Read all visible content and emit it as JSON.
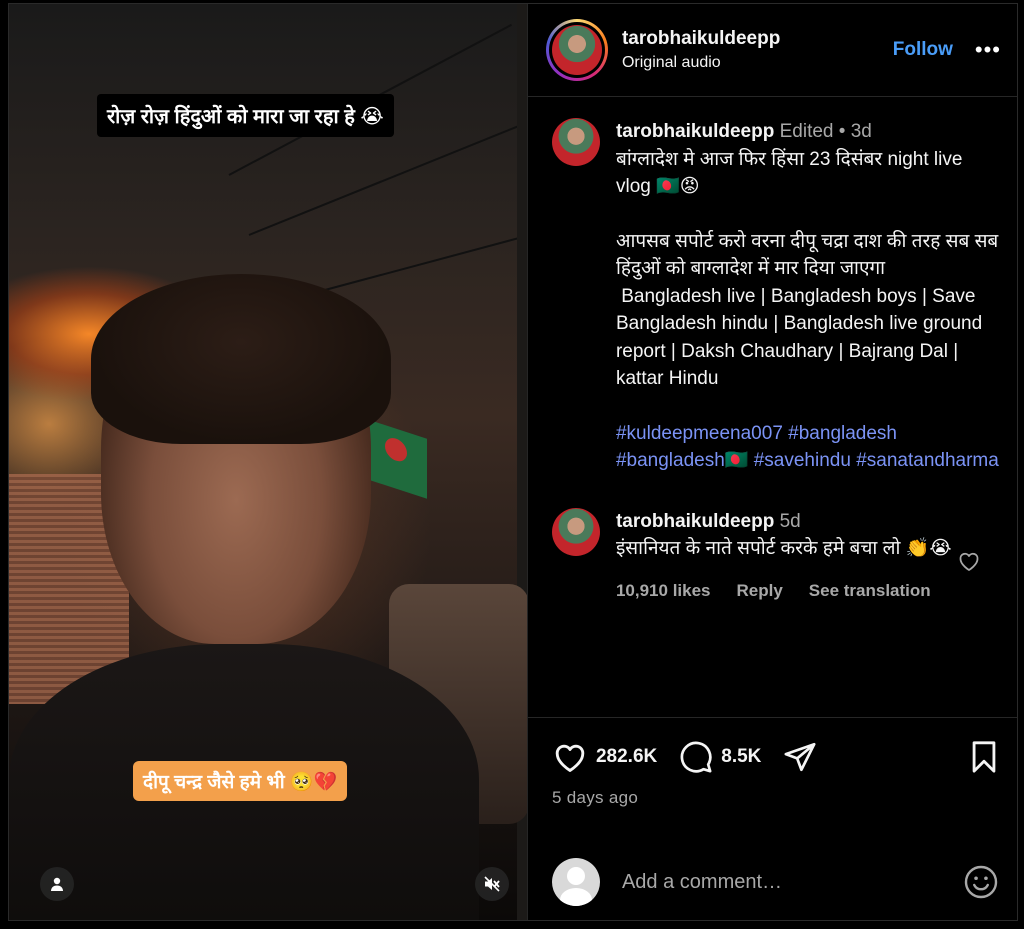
{
  "video": {
    "caption_top": "रोज़ रोज़ हिंदुओं को मारा जा रहा हे 😭",
    "caption_bottom": "दीपू चन्द्र जैसे हमे भी 🥺💔"
  },
  "header": {
    "username": "tarobhaikuldeepp",
    "audio": "Original audio",
    "follow_label": "Follow",
    "more_label": "•••"
  },
  "post": {
    "username": "tarobhaikuldeepp",
    "edited": "Edited",
    "time": "3d",
    "caption_line1": "बांग्लादेश मे आज फिर हिंसा 23 दिसंबर night live vlog 🇧🇩😡",
    "caption_line2": "आपसब सपोर्ट करो वरना दीपू चद्रा दाश की तरह सब सब हिंदुओं को बाग्लादेश में मार दिया जाएगा",
    "caption_line3": " Bangladesh live | Bangladesh boys | Save Bangladesh hindu | Bangladesh live ground report | Daksh Chaudhary | Bajrang Dal | kattar Hindu",
    "hashtags": [
      "#kuldeepmeena007",
      "#bangladesh",
      "#bangladesh🇧🇩",
      "#savehindu",
      "#sanatandharma"
    ]
  },
  "comment": {
    "username": "tarobhaikuldeepp",
    "time": "5d",
    "text": "इंसानियत के नाते सपोर्ट करके हमे बचा लो 👏😭",
    "likes": "10,910 likes",
    "reply": "Reply",
    "translate": "See translation"
  },
  "actions": {
    "like_count": "282.6K",
    "comment_count": "8.5K",
    "date": "5 days ago"
  },
  "add_comment": {
    "placeholder": "Add a comment…"
  },
  "colors": {
    "link": "#4a9df8",
    "hashtag": "#7b93f5",
    "muted": "#a8a8a8",
    "caption_highlight": "#f3a04b"
  }
}
